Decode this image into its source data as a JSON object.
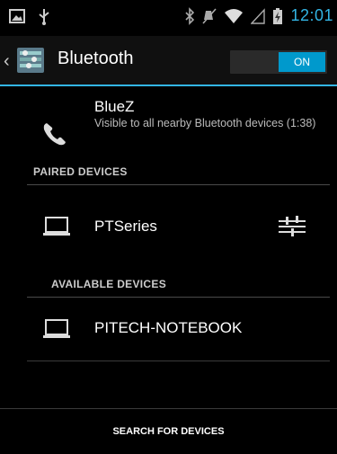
{
  "status_bar": {
    "time": "12:01",
    "icons": [
      "screenshot-icon",
      "usb-icon",
      "bluetooth-icon",
      "mute-icon",
      "wifi-icon",
      "signal-icon",
      "battery-icon"
    ]
  },
  "action_bar": {
    "title": "Bluetooth",
    "toggle_label": "ON",
    "accent": "#33b5e5"
  },
  "this_device": {
    "name": "BlueZ",
    "status": "Visible to all nearby Bluetooth devices (1:38)"
  },
  "paired": {
    "header": "PAIRED DEVICES",
    "devices": [
      {
        "name": "PTSeries"
      }
    ]
  },
  "available": {
    "header": "AVAILABLE DEVICES",
    "devices": [
      {
        "name": "PITECH-NOTEBOOK"
      }
    ]
  },
  "bottom": {
    "search_label": "SEARCH FOR DEVICES"
  }
}
